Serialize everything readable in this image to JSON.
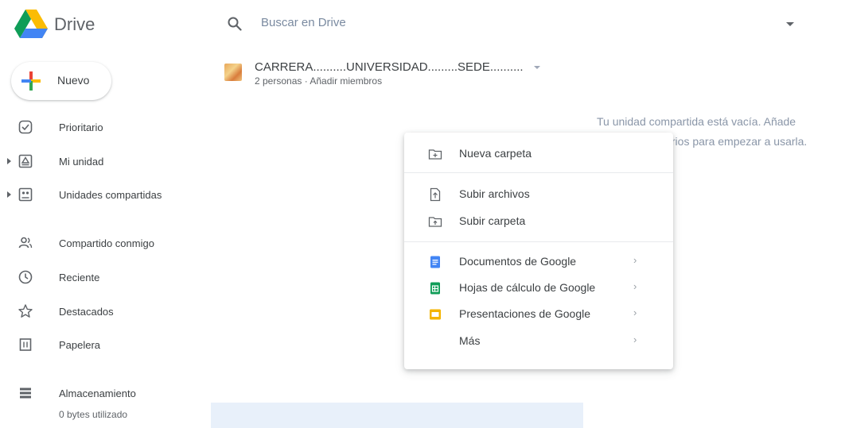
{
  "header": {
    "brand": "Drive",
    "search_placeholder": "Buscar en Drive"
  },
  "new_button": {
    "label": "Nuevo"
  },
  "sidebar": {
    "items": [
      {
        "label": "Prioritario",
        "icon": "priority-icon"
      },
      {
        "label": "Mi unidad",
        "icon": "my-drive-icon"
      },
      {
        "label": "Unidades compartidas",
        "icon": "shared-drives-icon"
      },
      {
        "label": "Compartido conmigo",
        "icon": "shared-with-me-icon"
      },
      {
        "label": "Reciente",
        "icon": "clock-icon"
      },
      {
        "label": "Destacados",
        "icon": "star-icon"
      },
      {
        "label": "Papelera",
        "icon": "trash-icon"
      },
      {
        "label": "Almacenamiento",
        "icon": "storage-icon"
      }
    ],
    "storage_used": "0 bytes utilizado"
  },
  "shared_drive": {
    "title": "CARRERA..........UNIVERSIDAD.........SEDE..........",
    "members": "2 personas · Añadir miembros",
    "empty_line1": "Tu unidad compartida está vacía. Añade",
    "empty_line2": "iarios para empezar a usarla."
  },
  "context_menu": {
    "items": [
      {
        "label": "Nueva carpeta",
        "icon": "new-folder-icon"
      },
      {
        "label": "Subir archivos",
        "icon": "file-upload-icon"
      },
      {
        "label": "Subir carpeta",
        "icon": "folder-upload-icon"
      },
      {
        "label": "Documentos de Google",
        "icon": "google-docs-icon",
        "submenu": true
      },
      {
        "label": "Hojas de cálculo de Google",
        "icon": "google-sheets-icon",
        "submenu": true
      },
      {
        "label": "Presentaciones de Google",
        "icon": "google-slides-icon",
        "submenu": true
      },
      {
        "label": "Más",
        "icon": "",
        "submenu": true
      }
    ]
  },
  "colors": {
    "docs": "#4285f4",
    "sheets": "#0f9d58",
    "slides": "#f4b400",
    "text": "#3c4043",
    "muted": "#5f6368"
  }
}
